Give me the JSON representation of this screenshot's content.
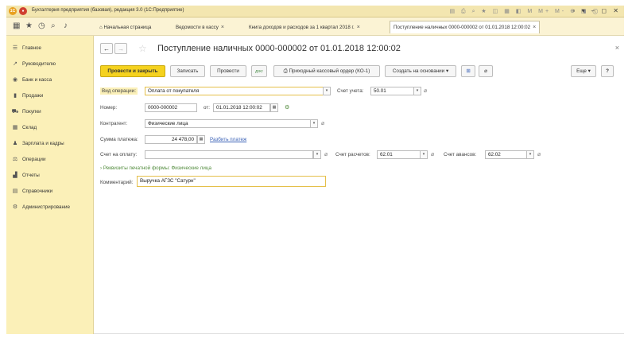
{
  "window": {
    "title": "Бухгалтерия предприятия (базовая), редакция 3.0  (1С:Предприятие)",
    "win_controls": "▫ ▾ – ◻ ✕",
    "tool_icons": "▤ ⎙ ⌕ ★ ◫ ▦ ◧ M M+ M- ⊕ ◨ ⓘ"
  },
  "topbar": {
    "tabs": [
      {
        "label": "Начальная страница",
        "close": ""
      },
      {
        "label": "Ведомости в кассу",
        "close": "×"
      },
      {
        "label": "Книга доходов и расходов за 1 квартал 2018 г.",
        "close": "×"
      },
      {
        "label": "Поступление наличных 0000-000002 от 01.01.2018 12:00:02",
        "close": "×"
      }
    ]
  },
  "sidebar": {
    "items": [
      {
        "label": "Главное",
        "icon": "☰"
      },
      {
        "label": "Руководителю",
        "icon": "↗"
      },
      {
        "label": "Банк и касса",
        "icon": "◉"
      },
      {
        "label": "Продажи",
        "icon": "▮"
      },
      {
        "label": "Покупки",
        "icon": "⛟"
      },
      {
        "label": "Склад",
        "icon": "▦"
      },
      {
        "label": "Зарплата и кадры",
        "icon": "♟"
      },
      {
        "label": "Операции",
        "icon": "⚖"
      },
      {
        "label": "Отчеты",
        "icon": "▟"
      },
      {
        "label": "Справочники",
        "icon": "▤"
      },
      {
        "label": "Администрирование",
        "icon": "⚙"
      }
    ]
  },
  "document": {
    "title": "Поступление наличных 0000-000002 от 01.01.2018 12:00:02",
    "close": "×"
  },
  "toolbar": {
    "post_close": "Провести и закрыть",
    "save": "Записать",
    "post": "Провести",
    "dt_kt": "ДтКт",
    "print_order": "Приходный кассовый ордер (КО-1)",
    "create_basis": "Создать на основании",
    "more": "Еще",
    "help": "?"
  },
  "form": {
    "operation_label": "Вид операции:",
    "operation_value": "Оплата от покупателя",
    "account_label": "Счет учета:",
    "account_value": "50.01",
    "number_label": "Номер:",
    "number_value": "0000-000002",
    "date_label": "от:",
    "date_value": "01.01.2018 12:00:02",
    "counterparty_label": "Контрагент:",
    "counterparty_value": "Физические лица",
    "amount_label": "Сумма платежа:",
    "amount_value": "24 478,00",
    "split_link": "Разбить платеж",
    "invoice_label": "Счет на оплату:",
    "invoice_value": "",
    "settle_label": "Счет расчетов:",
    "settle_value": "62.01",
    "advance_label": "Счет авансов:",
    "advance_value": "62.02",
    "print_group": "Реквизиты печатной формы: Физические лица",
    "comment_label": "Комментарий:",
    "comment_value": "Выручка АГЗС \"Сатурн\""
  },
  "colors": {
    "accent_button": "#f5d21e",
    "sidebar_bg": "#fbf0b8",
    "link": "#3b62b7",
    "group_text": "#4f8a3a"
  }
}
